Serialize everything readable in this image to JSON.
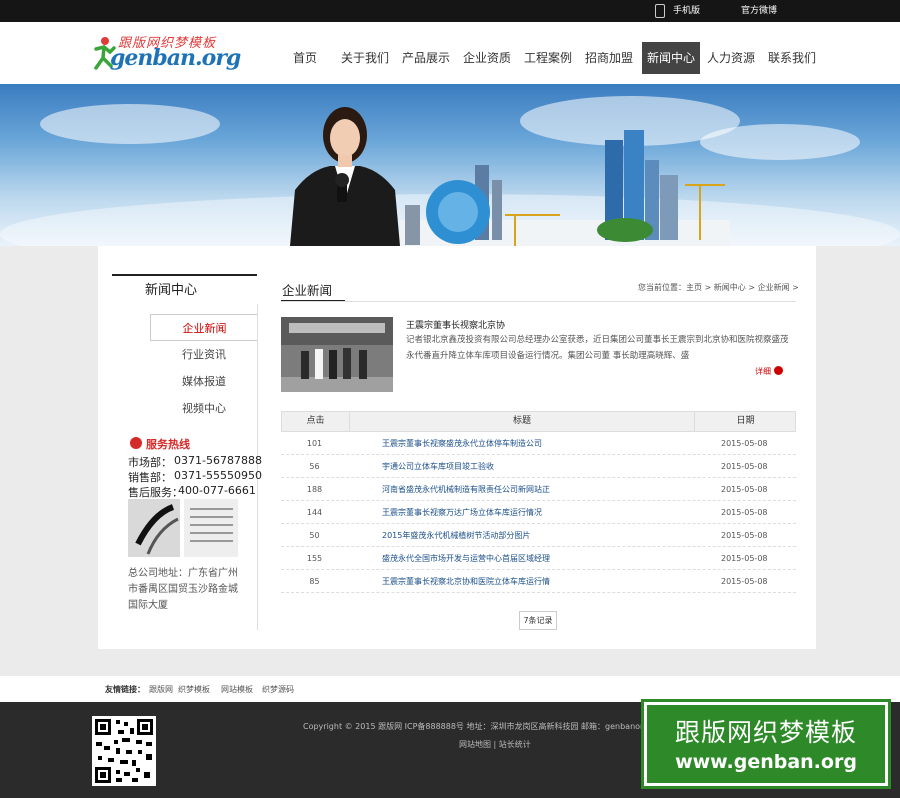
{
  "topbar": {
    "mobile": "手机版",
    "weibo": "官方微博"
  },
  "logo": {
    "cn": "跟版网织梦模板",
    "en": "genban.org"
  },
  "nav": {
    "items": [
      "首页",
      "关于我们",
      "产品展示",
      "企业资质",
      "工程案例",
      "招商加盟",
      "新闻中心",
      "人力资源",
      "联系我们"
    ],
    "active": "新闻中心"
  },
  "sidebar": {
    "title": "新闻中心",
    "menu": [
      "企业新闻",
      "行业资讯",
      "媒体报道",
      "视频中心"
    ],
    "active": "企业新闻",
    "hotline_title": "服务热线",
    "contacts": [
      {
        "label": "市场部：",
        "value": "0371-56787888"
      },
      {
        "label": "销售部：",
        "value": "0371-55550950"
      },
      {
        "label": "售后服务：",
        "value": "400-077-6661"
      }
    ],
    "address": "总公司地址：广东省广州市番禺区国贸玉沙路金城国际大厦"
  },
  "content": {
    "section_title": "企业新闻",
    "breadcrumb": "您当前位置：主页 > 新闻中心 > 企业新闻 >",
    "featured": {
      "title": "王震宗董事长视察北京协",
      "summary": "记者银北京鑫茂投资有限公司总经理办公室获悉，近日集团公司董事长王震宗到北京协和医院视察盛茂永代番直升降立体车库项目设备运行情况。集团公司董 事长助理高晓辉、盛",
      "more": "详细"
    },
    "table": {
      "headers": [
        "点击",
        "标题",
        "日期"
      ],
      "rows": [
        {
          "clicks": "101",
          "title": "王震宗董事长视察盛茂永代立体停车制造公司",
          "date": "2015-05-08"
        },
        {
          "clicks": "56",
          "title": "宇通公司立体车库项目竣工验收",
          "date": "2015-05-08"
        },
        {
          "clicks": "188",
          "title": "河南省盛茂永代机械制造有限责任公司新网站正",
          "date": "2015-05-08"
        },
        {
          "clicks": "144",
          "title": "王震宗董事长视察万达广场立体车库运行情况",
          "date": "2015-05-08"
        },
        {
          "clicks": "50",
          "title": "2015年盛茂永代机械植树节活动部分图片",
          "date": "2015-05-08"
        },
        {
          "clicks": "155",
          "title": "盛茂永代全国市场开发与运营中心首届区域经理",
          "date": "2015-05-08"
        },
        {
          "clicks": "85",
          "title": "王震宗董事长视察北京协和医院立体车库运行情",
          "date": "2015-05-08"
        }
      ]
    },
    "pager": "7条记录"
  },
  "friend_links": {
    "label": "友情链接：",
    "items": [
      "跟版网",
      "织梦模板",
      "网站模板",
      "织梦源码"
    ]
  },
  "footer": {
    "copyright": "Copyright © 2015   跟版网 ICP备888888号 地址：深圳市龙岗区高新科技园 邮箱：genbanorg",
    "links": "网站地图 | 站长统计"
  },
  "watermark": {
    "line1": "跟版网织梦模板",
    "line2": "www.genban.org"
  }
}
